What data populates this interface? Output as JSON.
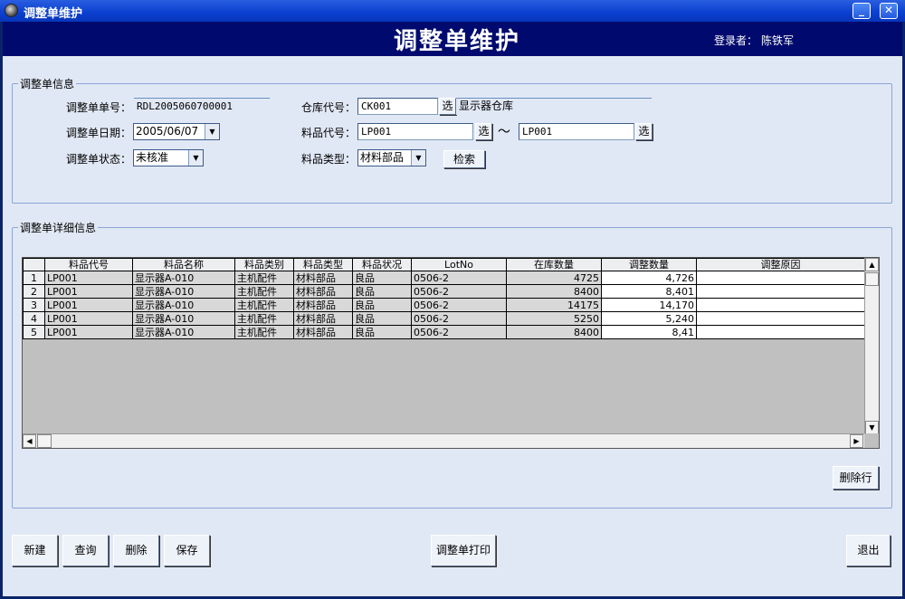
{
  "window": {
    "title": "调整单维护",
    "min_label": "_",
    "close_label": "✕"
  },
  "header": {
    "title": "调整单维护",
    "login_label": "登录者：",
    "user": "陈铁军"
  },
  "info": {
    "legend": "调整单信息",
    "order_no_label": "调整单单号：",
    "order_no": "RDL2005060700001",
    "date_label": "调整单日期：",
    "date": "2005/06/07",
    "status_label": "调整单状态：",
    "status": "未核准",
    "warehouse_label": "仓库代号：",
    "warehouse_code": "CK001",
    "warehouse_name": "显示器仓库",
    "item_label": "料品代号：",
    "item_from": "LP001",
    "item_to": "LP001",
    "tilde": "～",
    "type_label": "料品类型：",
    "type": "材料部品",
    "pick_label": "选",
    "search_label": "检索"
  },
  "detail": {
    "legend": "调整单详细信息",
    "columns": [
      "料品代号",
      "料品名称",
      "料品类别",
      "料品类型",
      "料品状况",
      "LotNo",
      "在库数量",
      "调整数量",
      "调整原因"
    ],
    "rows": [
      {
        "no": "1",
        "code": "LP001",
        "name": "显示器A-010",
        "category": "主机配件",
        "type": "材料部品",
        "condition": "良品",
        "lot": "0506-2",
        "stock": "4725",
        "adjust": "4,726",
        "reason": ""
      },
      {
        "no": "2",
        "code": "LP001",
        "name": "显示器A-010",
        "category": "主机配件",
        "type": "材料部品",
        "condition": "良品",
        "lot": "0506-2",
        "stock": "8400",
        "adjust": "8,401",
        "reason": ""
      },
      {
        "no": "3",
        "code": "LP001",
        "name": "显示器A-010",
        "category": "主机配件",
        "type": "材料部品",
        "condition": "良品",
        "lot": "0506-2",
        "stock": "14175",
        "adjust": "14,170",
        "reason": ""
      },
      {
        "no": "4",
        "code": "LP001",
        "name": "显示器A-010",
        "category": "主机配件",
        "type": "材料部品",
        "condition": "良品",
        "lot": "0506-2",
        "stock": "5250",
        "adjust": "5,240",
        "reason": ""
      },
      {
        "no": "5",
        "code": "LP001",
        "name": "显示器A-010",
        "category": "主机配件",
        "type": "材料部品",
        "condition": "良品",
        "lot": "0506-2",
        "stock": "8400",
        "adjust": "8,41",
        "reason": ""
      }
    ],
    "delete_row_label": "删除行"
  },
  "actions": {
    "new_label": "新建",
    "query_label": "查询",
    "delete_label": "删除",
    "save_label": "保存",
    "print_label": "调整单打印",
    "exit_label": "退出"
  }
}
